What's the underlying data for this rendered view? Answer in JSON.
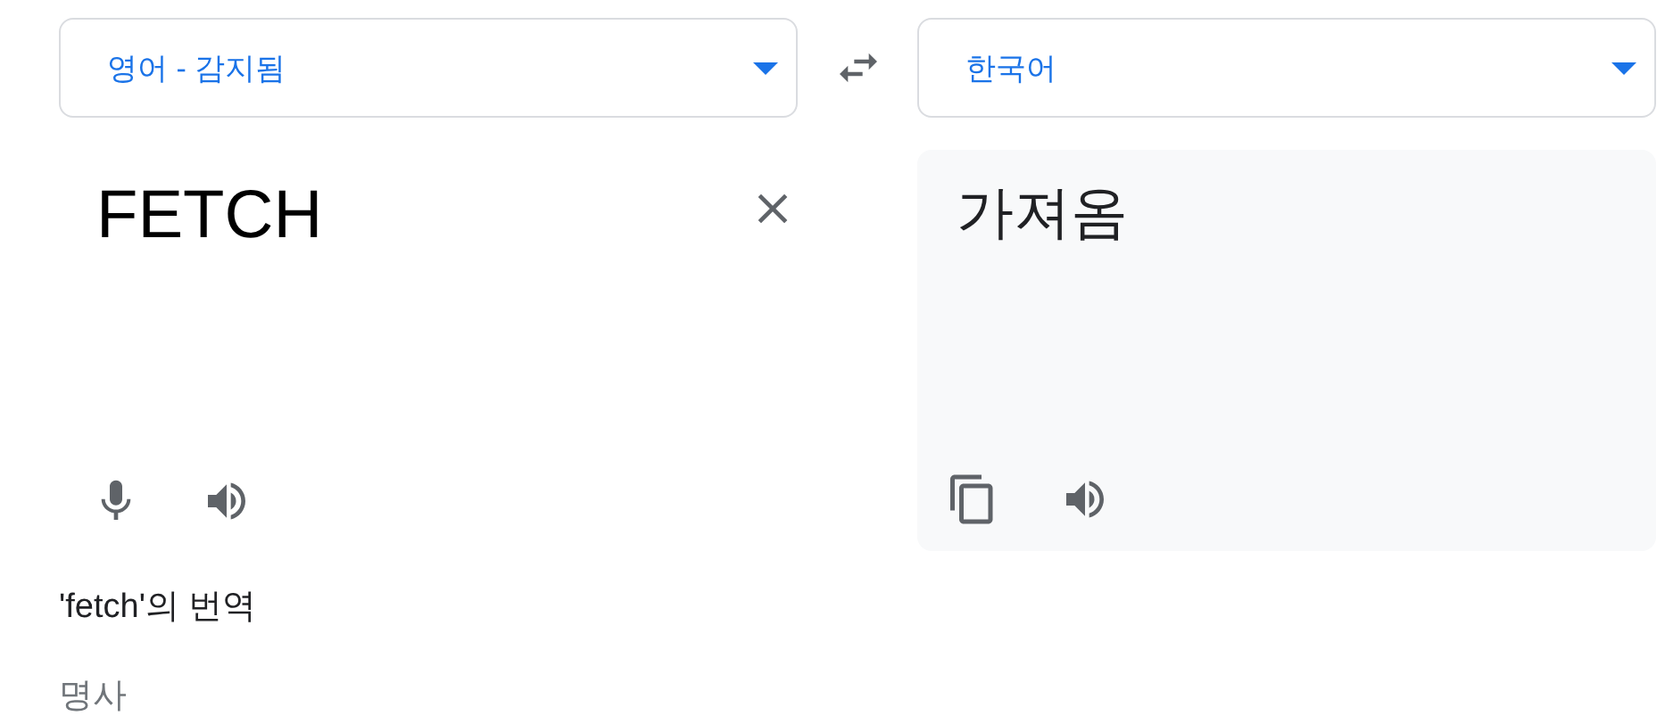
{
  "source_language": {
    "label": "영어 - 감지됨"
  },
  "target_language": {
    "label": "한국어"
  },
  "source": {
    "value": "FETCH"
  },
  "target": {
    "text": "가져옴"
  },
  "translation_heading": "'fetch'의 번역",
  "part_of_speech": "명사"
}
